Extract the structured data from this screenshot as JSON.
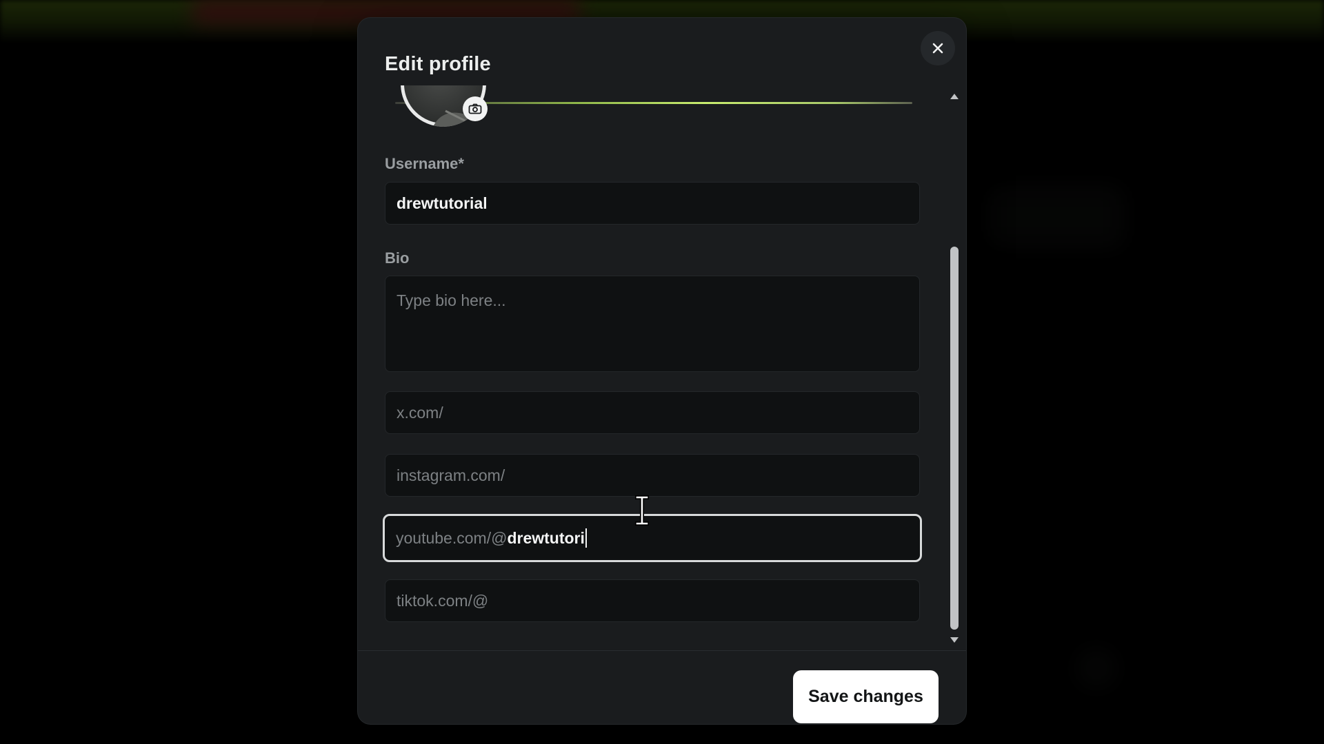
{
  "modal": {
    "title": "Edit profile",
    "close_icon": "close-icon"
  },
  "avatar": {
    "camera_icon": "camera-icon"
  },
  "username": {
    "label": "Username*",
    "value": "drewtutorial"
  },
  "bio": {
    "label": "Bio",
    "placeholder": "Type bio here..."
  },
  "socials": {
    "x_prefix": "x.com/",
    "instagram_prefix": "instagram.com/",
    "youtube_prefix": "youtube.com/@",
    "youtube_value": "drewtutori",
    "tiktok_prefix": "tiktok.com/@"
  },
  "footer": {
    "save_label": "Save changes"
  },
  "colors": {
    "modal_bg": "#1a1c1e",
    "input_bg": "#0f1112",
    "accent_green": "#c8ec6f",
    "button_bg": "#ffffff"
  }
}
